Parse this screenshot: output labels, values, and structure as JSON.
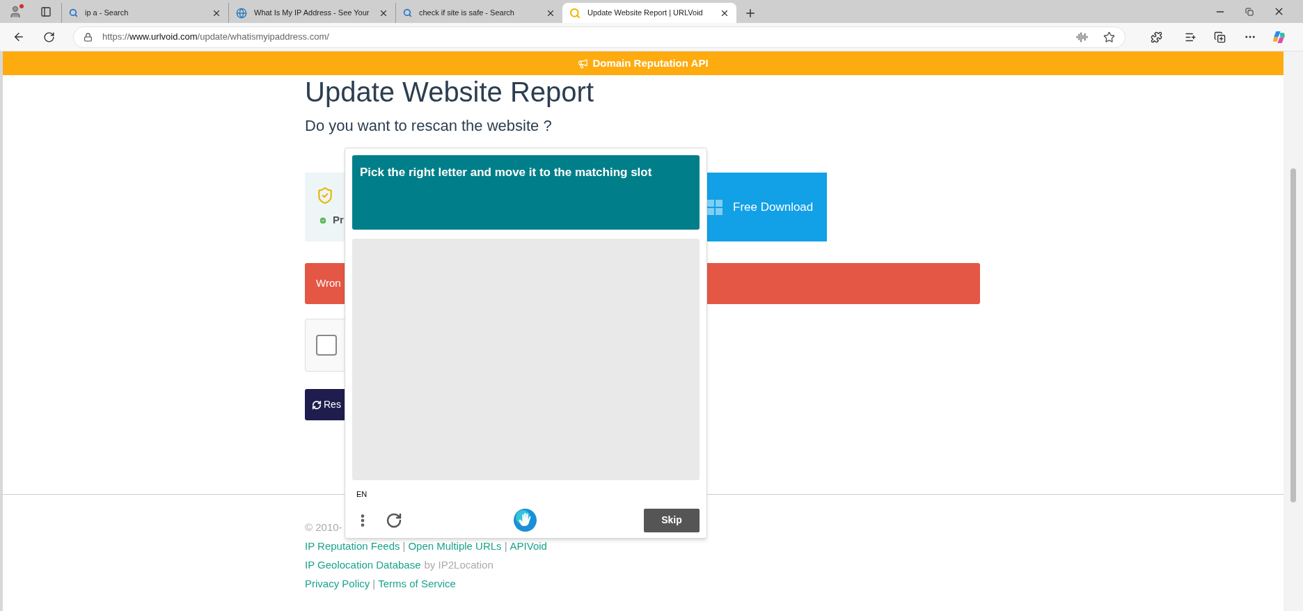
{
  "browser": {
    "tabs": [
      {
        "title": "ip a - Search",
        "kind": "search",
        "selected": false
      },
      {
        "title": "What Is My IP Address - See Your",
        "kind": "globe",
        "selected": false
      },
      {
        "title": "check if site is safe - Search",
        "kind": "search",
        "selected": false
      },
      {
        "title": "Update Website Report | URLVoid",
        "kind": "loading",
        "selected": true
      }
    ],
    "address_bar": {
      "scheme": "https://",
      "host": "www.urlvoid.com",
      "path": "/update/whatismyipaddress.com/"
    }
  },
  "banner": {
    "text": "Domain Reputation API"
  },
  "page": {
    "title": "Update Website Report",
    "subtitle": "Do you want to rescan the website ?",
    "status_box": {
      "text": "Pr"
    },
    "download_button": "Free Download",
    "alert": "Wron",
    "checkbox": {
      "checked": false
    },
    "rescan_button": "Res"
  },
  "footer": {
    "copyright": "© 2010-",
    "separator": "|",
    "links_row": [
      "IP Reputation Feeds",
      "Open Multiple URLs",
      "APIVoid"
    ],
    "geolocation": {
      "link": "IP Geolocation Database",
      "suffix": "by IP2Location"
    },
    "legal_links": [
      "Privacy Policy",
      "Terms of Service"
    ]
  },
  "captcha": {
    "prompt": "Pick the right letter and move it to the matching slot",
    "language": "EN",
    "skip_button": "Skip"
  }
}
